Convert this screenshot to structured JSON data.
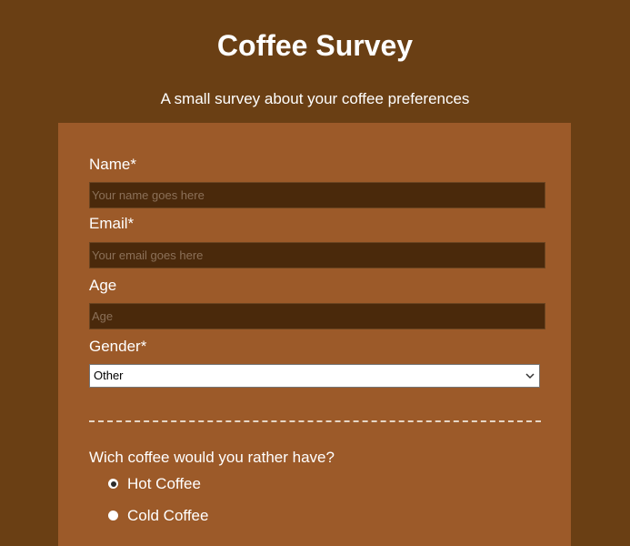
{
  "header": {
    "title": "Coffee Survey",
    "subtitle": "A small survey about your coffee preferences"
  },
  "form": {
    "name": {
      "label": "Name*",
      "placeholder": "Your name goes here",
      "value": ""
    },
    "email": {
      "label": "Email*",
      "placeholder": "Your email goes here",
      "value": ""
    },
    "age": {
      "label": "Age",
      "placeholder": "Age",
      "value": ""
    },
    "gender": {
      "label": "Gender*",
      "selected": "Other",
      "icon": "chevron-down-icon"
    },
    "coffee_question": {
      "label": "Wich coffee would you rather have?",
      "options": [
        {
          "label": "Hot Coffee",
          "checked": true
        },
        {
          "label": "Cold Coffee",
          "checked": false
        }
      ]
    }
  },
  "colors": {
    "page_background": "#6a3f14",
    "card_background": "#9c5a29",
    "input_background": "#4a290b",
    "text": "#ffffff"
  }
}
